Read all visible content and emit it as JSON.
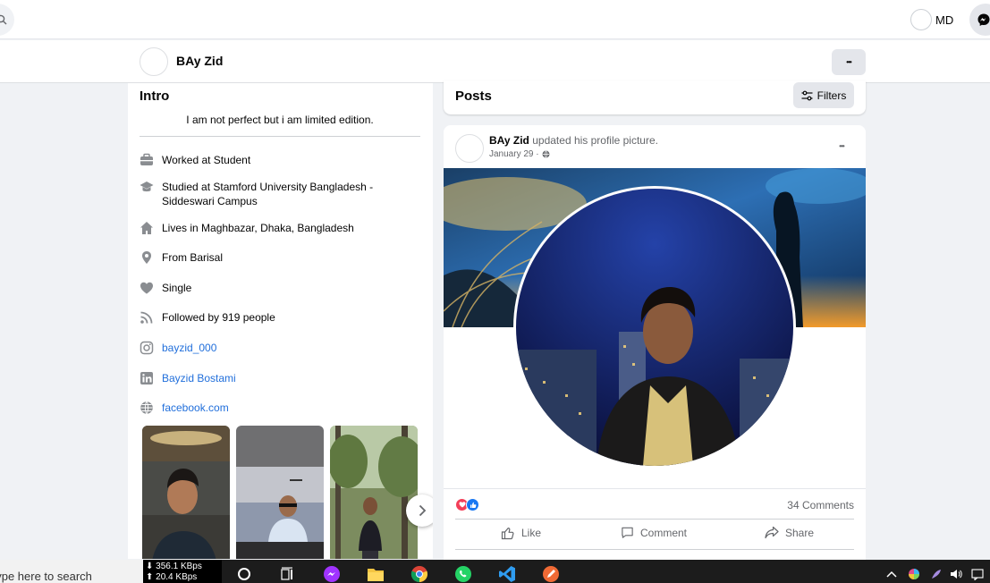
{
  "top_bar": {
    "me_name": "MD"
  },
  "profile_bar": {
    "name": "BAy Zid",
    "more_label": "•••"
  },
  "intro": {
    "title": "Intro",
    "bio": "I am not perfect but i am limited edition.",
    "details": [
      {
        "icon": "briefcase-icon",
        "text": "Worked at Student"
      },
      {
        "icon": "graduation-cap-icon",
        "text": "Studied at Stamford University Bangladesh - Siddeswari Campus"
      },
      {
        "icon": "home-icon",
        "text": "Lives in Maghbazar, Dhaka, Bangladesh"
      },
      {
        "icon": "location-pin-icon",
        "text": "From Barisal"
      },
      {
        "icon": "heart-icon",
        "text": "Single"
      },
      {
        "icon": "rss-icon",
        "text": "Followed by 919 people"
      },
      {
        "icon": "instagram-icon",
        "text": "bayzid_000"
      },
      {
        "icon": "linkedin-icon",
        "text": "Bayzid Bostami"
      },
      {
        "icon": "globe-icon",
        "text": "facebook.com"
      }
    ]
  },
  "posts": {
    "title": "Posts",
    "filters_label": "Filters"
  },
  "post": {
    "author": "BAy Zid",
    "action_text": "updated his profile picture.",
    "date": "January 29 ·",
    "more_label": "•••",
    "comments": "34 Comments",
    "like_label": "Like",
    "comment_label": "Comment",
    "share_label": "Share"
  },
  "taskbar": {
    "search_text": "Type here to search",
    "net_speed": "⬇ 356.1 KBps",
    "net_speed_up": "⬆ 20.4 KBps"
  },
  "colors": {
    "accent": "#1877f2",
    "link": "#216fdb",
    "like_red": "#f33e58"
  }
}
